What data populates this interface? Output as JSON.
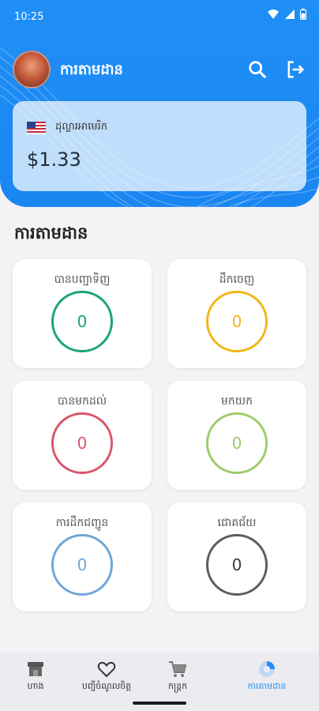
{
  "status": {
    "time": "10:25"
  },
  "header": {
    "title": "ការតាមដាន",
    "search_icon": "search-icon",
    "logout_icon": "logout-icon"
  },
  "balance": {
    "currency_name": "ដុល្លារអាមេរិក",
    "amount": "$1.33",
    "flag_icon": "us-flag-icon"
  },
  "section_title": "ការតាមដាន",
  "cards": [
    {
      "label": "បានបញ្ជាទិញ",
      "value": "0",
      "color": "#1aa37a"
    },
    {
      "label": "ដឹកចេញ",
      "value": "0",
      "color": "#f2b619"
    },
    {
      "label": "បានមកដល់",
      "value": "0",
      "color": "#d9566b"
    },
    {
      "label": "មកយក",
      "value": "0",
      "color": "#9fcc6b"
    },
    {
      "label": "ការដឹកជញ្ជូន",
      "value": "0",
      "color": "#6ea6d9"
    },
    {
      "label": "ជោគជ័យ",
      "value": "0",
      "color": "#5d5d5d"
    }
  ],
  "nav": [
    {
      "label": "ហាង",
      "icon": "store-icon"
    },
    {
      "label": "បញ្ជីចំណូលចិត្ត",
      "icon": "heart-icon"
    },
    {
      "label": "កន្ត្រក",
      "icon": "cart-icon"
    },
    {
      "label": "ការតាមដាន",
      "icon": "tracking-icon",
      "active": true
    }
  ],
  "colors": {
    "primary": "#1f8ff5"
  }
}
